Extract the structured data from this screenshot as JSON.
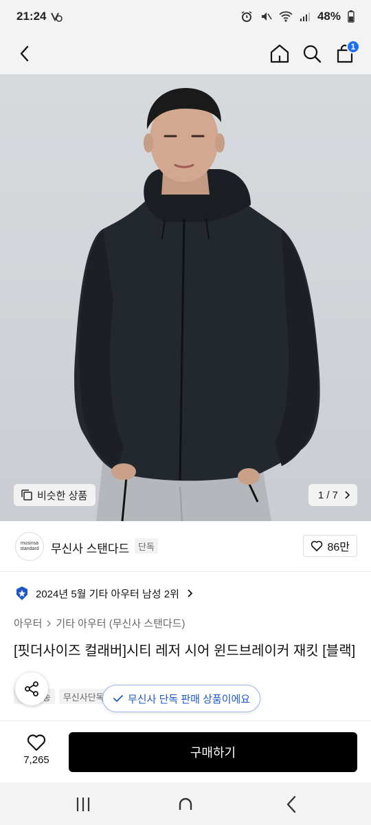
{
  "status_bar": {
    "time": "21:24",
    "battery": "48%"
  },
  "nav": {
    "cart_count": "1"
  },
  "hero": {
    "similar_label": "비슷한 상품",
    "page_indicator": "1 / 7"
  },
  "brand": {
    "logo_line1": "musinsa",
    "logo_line2": "standard",
    "name": "무신사 스탠다드",
    "tag": "단독",
    "likes": "86만"
  },
  "product": {
    "ranking": "2024년 5월 기타 아우터 남성 2위",
    "breadcrumb": [
      "아우터",
      "기타 아우터 (무신사 스탠다드)"
    ],
    "title": "[핏더사이즈 컬래버]시티 레저 시어 윈드브레이커 재킷 [블랙]",
    "tags": [
      "무료배송",
      "무신사단독"
    ]
  },
  "toast": {
    "text": "무신사 단독 판매 상품이에요"
  },
  "buy_bar": {
    "wish_count": "7,265",
    "buy_label": "구매하기"
  },
  "colors": {
    "accent_blue": "#1e6ff0",
    "toast_text": "#1e58c8",
    "buy_button": "#000000"
  }
}
